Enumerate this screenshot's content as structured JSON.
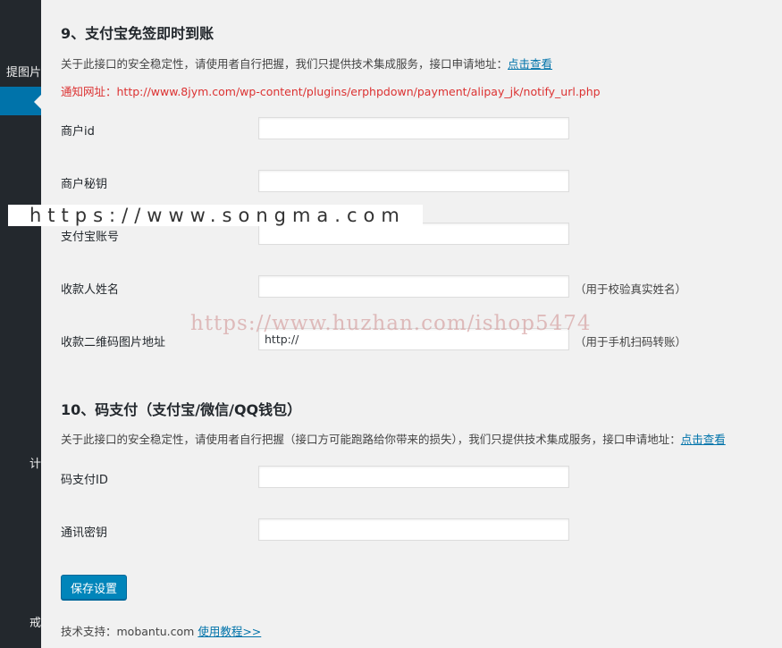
{
  "sidebar": {
    "items": [
      {
        "label": "提图片"
      },
      {
        "label": "计"
      },
      {
        "label": "戒"
      }
    ]
  },
  "section9": {
    "title": "9、支付宝免签即时到账",
    "desc": "关于此接口的安全稳定性，请使用者自行把握，我们只提供技术集成服务，接口申请地址：",
    "link": "点击查看",
    "notify": "通知网址：http://www.8jym.com/wp-content/plugins/erphpdown/payment/alipay_jk/notify_url.php",
    "fields": [
      {
        "label": "商户id",
        "value": "",
        "hint": ""
      },
      {
        "label": "商户秘钥",
        "value": "",
        "hint": ""
      },
      {
        "label": "支付宝账号",
        "value": "",
        "hint": ""
      },
      {
        "label": "收款人姓名",
        "value": "",
        "hint": "（用于校验真实姓名）"
      },
      {
        "label": "收款二维码图片地址",
        "value": "http://",
        "hint": "（用于手机扫码转账）"
      }
    ]
  },
  "section10": {
    "title": "10、码支付（支付宝/微信/QQ钱包）",
    "desc": "关于此接口的安全稳定性，请使用者自行把握（接口方可能跑路给你带来的损失），我们只提供技术集成服务，接口申请地址：",
    "link": "点击查看",
    "fields": [
      {
        "label": "码支付ID",
        "value": ""
      },
      {
        "label": "通讯密钥",
        "value": ""
      }
    ]
  },
  "save_label": "保存设置",
  "support": {
    "text": "技术支持：mobantu.com",
    "link": "使用教程>>"
  },
  "watermarks": {
    "top": "https://www.songma.com",
    "middle": "https://www.huzhan.com/ishop5474"
  },
  "colors": {
    "sidebar_bg": "#23282d",
    "accent": "#0073aa",
    "button": "#0085ba",
    "notify_red": "#dc3232",
    "page_bg": "#f1f1f1"
  }
}
